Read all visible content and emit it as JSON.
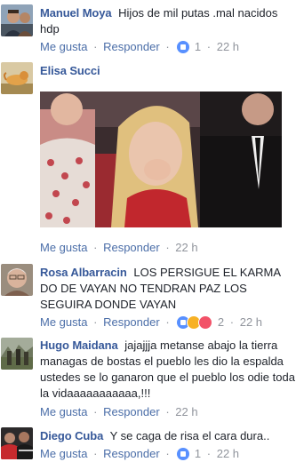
{
  "comments": [
    {
      "author": "Manuel Moya",
      "text": "Hijos de mil putas .mal nacidos hdp",
      "like_label": "Me gusta",
      "reply_label": "Responder",
      "reaction_count": "1",
      "time": "22 h"
    },
    {
      "author": "Elisa Succi",
      "text": "",
      "like_label": "Me gusta",
      "reply_label": "Responder",
      "time": "22 h"
    },
    {
      "author": "Rosa Albarracin",
      "text": "LOS PERSIGUE EL KARMA DO DE VAYAN NO TENDRAN PAZ LOS SEGUIRA DONDE VAYAN",
      "like_label": "Me gusta",
      "reply_label": "Responder",
      "reaction_count": "2",
      "time": "22 h"
    },
    {
      "author": "Hugo Maidana",
      "text": "jajajjja metanse abajo la tierra managas de bostas el pueblo les dio la espalda ustedes se lo ganaron que el pueblo los odie toda la vidaaaaaaaaaaa,!!!",
      "like_label": "Me gusta",
      "reply_label": "Responder",
      "time": "22 h"
    },
    {
      "author": "Diego Cuba",
      "text": "Y se caga de risa el cara dura..",
      "like_label": "Me gusta",
      "reply_label": "Responder",
      "reaction_count": "1",
      "time": "22 h"
    }
  ],
  "icons": {
    "like": "like-reaction-icon",
    "haha": "haha-reaction-icon",
    "love": "love-reaction-icon"
  },
  "colors": {
    "name": "#365899",
    "action": "#4b6ea8",
    "meta": "#90949c",
    "like": "#5890ff"
  }
}
